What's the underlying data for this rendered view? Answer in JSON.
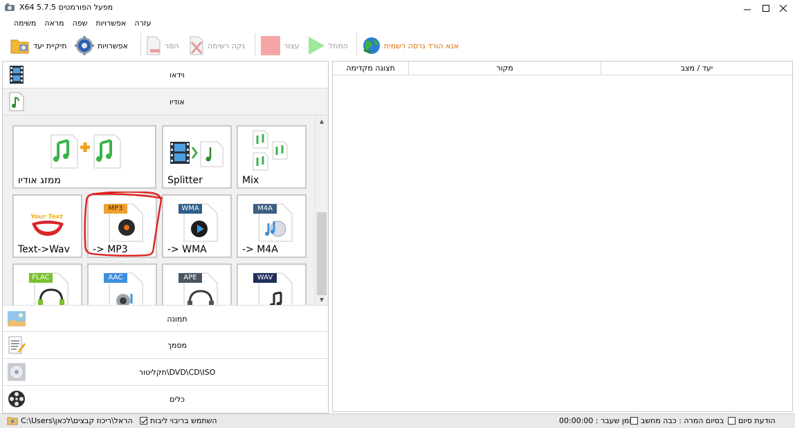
{
  "window": {
    "title": "X64 5.7.5 מפעל הפורמטים"
  },
  "menu": [
    "משימה",
    "מראה",
    "שפה",
    "אפשרויות",
    "עזרה"
  ],
  "toolbar": {
    "output_folder": "תיקיית יעד",
    "options": "אפשרויות",
    "remove": "הסר",
    "clear_list": "נקה רשימה",
    "stop": "עצור",
    "start": "התחל",
    "download_official": "אנא הורד גרסה רשמית"
  },
  "categories": {
    "video": "וידאו",
    "audio": "אודיו",
    "picture": "תמונה",
    "document": "מסמך",
    "rom": "תקליטור\\DVD\\CD\\ISO",
    "tools": "כלים"
  },
  "tiles": {
    "joiner": "ממזג אודיו",
    "splitter": "Splitter",
    "mix": "Mix",
    "text_to_wav": "Text->Wav",
    "to_mp3": "-> MP3",
    "to_wma": "-> WMA",
    "to_m4a": "-> M4A",
    "badge_mp3": "MP3",
    "badge_wma": "WMA",
    "badge_m4a": "M4A",
    "badge_flac": "FLAC",
    "badge_aac": "AAC",
    "badge_ape": "APE",
    "badge_wav": "WAV",
    "your_text": "Your Text"
  },
  "file_list": {
    "columns": [
      "תצוגה מקדימה",
      "מקור",
      "יעד / מצב"
    ]
  },
  "status": {
    "path": "C:\\Users\\הראל\\ריכוז קבצים\\לכאן",
    "multithread": "השתמש בריבוי ליבות",
    "elapsed": "00:00:00 : זמן שעבר",
    "on_finish": "בסיום המרה : כבה מחשב",
    "notify": "הודעת סיום"
  },
  "colors": {
    "accent_orange": "#e06c00",
    "highlight_red": "#e0201e",
    "mp3_badge": "#f0a030",
    "wma_badge": "#2f5f8a",
    "m4a_badge": "#3c5f82",
    "flac_badge": "#7ac030",
    "aac_badge": "#3f8fe0",
    "ape_badge": "#4a5560",
    "wav_badge": "#1f2e5a"
  }
}
